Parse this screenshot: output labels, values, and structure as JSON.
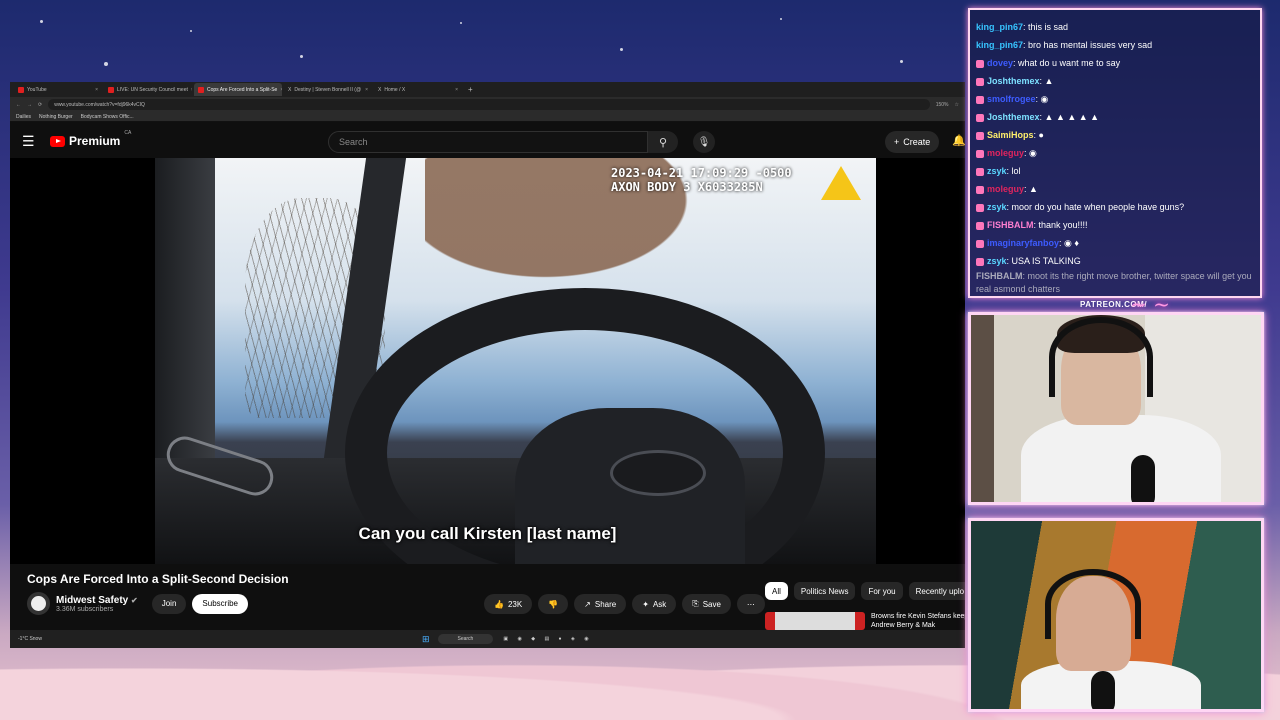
{
  "browser": {
    "tabs": [
      {
        "label": "YouTube",
        "active": false
      },
      {
        "label": "LIVE: UN Security Council meet",
        "active": false
      },
      {
        "label": "Cops Are Forced Into a Split-Se",
        "active": true
      },
      {
        "label": "Destiny | Steven Bonnell II (@",
        "active": false
      },
      {
        "label": "Home / X",
        "active": false
      }
    ],
    "url": "www.youtube.com/watch?v=fdj96k4vCIQ",
    "zoom": "150%",
    "bookmarks": [
      "Dailies",
      "Nothing Burger",
      "Bodycam Shows Offic..."
    ]
  },
  "youtube": {
    "logo": "Premium",
    "region": "CA",
    "search_placeholder": "Search",
    "create_label": "Create",
    "video": {
      "timestamp_line1": "2023-04-21 17:09:29 -0500",
      "timestamp_line2": "AXON BODY 3 X6033285N",
      "caption": "Can you call Kirsten [last name]"
    },
    "title": "Cops Are Forced Into a Split-Second Decision",
    "channel": {
      "name": "Midwest Safety",
      "subscribers": "3.36M subscribers"
    },
    "join_label": "Join",
    "subscribe_label": "Subscribe",
    "likes": "23K",
    "share_label": "Share",
    "ask_label": "Ask",
    "save_label": "Save",
    "chips": [
      "All",
      "Politics News",
      "For you",
      "Recently uplo"
    ],
    "recommendation": {
      "title": "Browns fire Kevin Stefans keep Andrew Berry & Mak"
    }
  },
  "taskbar": {
    "search": "Search",
    "weather": "-1°C Snow"
  },
  "chat": {
    "messages": [
      {
        "user": "king_pin67",
        "color": "#37c4ff",
        "text": "this is sad",
        "badge": false
      },
      {
        "user": "king_pin67",
        "color": "#37c4ff",
        "text": "bro has mental issues very sad",
        "badge": false
      },
      {
        "user": "dovey",
        "color": "#3d5cff",
        "text": "what do u want me to say",
        "badge": true
      },
      {
        "user": "Joshthemex",
        "color": "#7ce0ff",
        "text": "▲",
        "badge": true
      },
      {
        "user": "smolfrogee",
        "color": "#3d5cff",
        "text": "◉",
        "badge": true
      },
      {
        "user": "Joshthemex",
        "color": "#7ce0ff",
        "text": "▲ ▲ ▲ ▲ ▲",
        "badge": true
      },
      {
        "user": "SaimiHops",
        "color": "#ffef6b",
        "text": "●",
        "badge": true
      },
      {
        "user": "moleguy",
        "color": "#e0245e",
        "text": "◉",
        "badge": true
      },
      {
        "user": "zsyk",
        "color": "#5ad6ff",
        "text": "lol",
        "badge": true
      },
      {
        "user": "moleguy",
        "color": "#e0245e",
        "text": "▲",
        "badge": true
      },
      {
        "user": "zsyk",
        "color": "#5ad6ff",
        "text": "moor do you hate when people have guns?",
        "badge": true
      },
      {
        "user": "FISHBALM",
        "color": "#ff7fd0",
        "text": "thank you!!!!",
        "badge": true
      },
      {
        "user": "imaginaryfanboy",
        "color": "#3d5cff",
        "text": "◉ ♦",
        "badge": true
      },
      {
        "user": "zsyk",
        "color": "#5ad6ff",
        "text": "USA IS TALKING",
        "badge": true
      }
    ],
    "last_message": {
      "user": "FISHBALM",
      "text": "moot its the right move brother, twitter space will get you real asmond chatters"
    }
  },
  "overlay": {
    "patreon": "PATREON.COM/"
  }
}
